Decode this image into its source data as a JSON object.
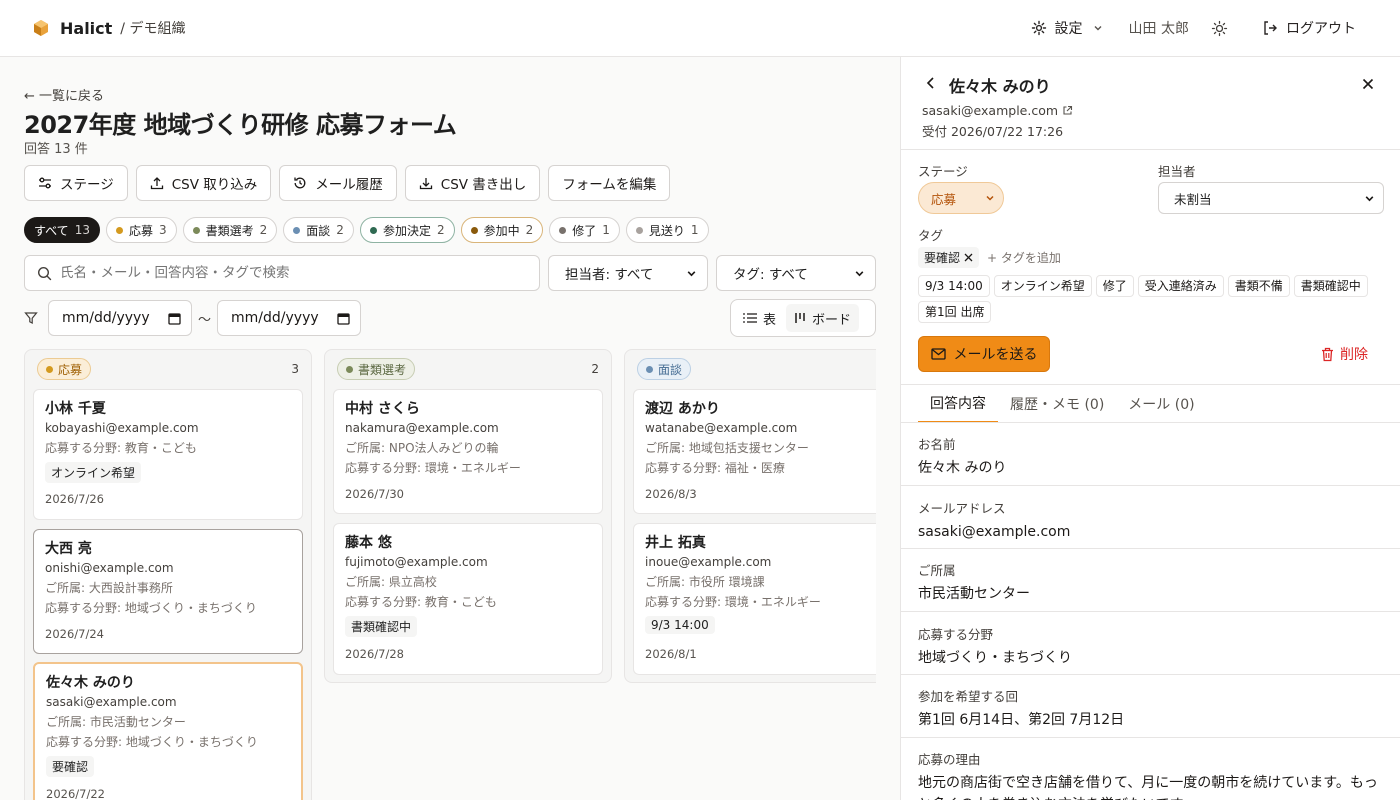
{
  "header": {
    "brand": "Halict",
    "org": "/ デモ組織",
    "settings_label": "設定",
    "user_name": "山田 太郎",
    "logout_label": "ログアウト"
  },
  "page": {
    "back_label": "← 一覧に戻る",
    "title": "2027年度 地域づくり研修 応募フォーム",
    "response_count": "回答 13 件"
  },
  "toolbar": {
    "stage": "ステージ",
    "csv_import": "CSV 取り込み",
    "mail_history": "メール履歴",
    "csv_export": "CSV 書き出し",
    "edit_form": "フォームを編集"
  },
  "filters": [
    {
      "label": "すべて",
      "count": "13",
      "color": ""
    },
    {
      "label": "応募",
      "count": "3",
      "color": "#d49a1f"
    },
    {
      "label": "書類選考",
      "count": "2",
      "color": "#7c8a5a"
    },
    {
      "label": "面談",
      "count": "2",
      "color": "#6b8fb3"
    },
    {
      "label": "参加決定",
      "count": "2",
      "color": "#2f6a52"
    },
    {
      "label": "参加中",
      "count": "2",
      "color": "#8a5a0c"
    },
    {
      "label": "修了",
      "count": "1",
      "color": "#78716c"
    },
    {
      "label": "見送り",
      "count": "1",
      "color": "#a8a29e"
    }
  ],
  "search": {
    "placeholder": "氏名・メール・回答内容・タグで検索"
  },
  "assignee_filter": "担当者: すべて",
  "tag_filter": "タグ: すべて",
  "date_from": "mm/dd/yyyy",
  "date_to": "mm/dd/yyyy",
  "date_sep": "〜",
  "view": {
    "table": "表",
    "board": "ボード"
  },
  "columns": [
    {
      "stage": "応募",
      "count": "3",
      "cards": [
        {
          "name": "小林 千夏",
          "email": "kobayashi@example.com",
          "lines": [
            "応募する分野: 教育・こども"
          ],
          "tag": "オンライン希望",
          "date": "2026/7/26"
        },
        {
          "name": "大西 亮",
          "email": "onishi@example.com",
          "lines": [
            "ご所属: 大西設計事務所",
            "応募する分野: 地域づくり・まちづくり"
          ],
          "tag": "",
          "date": "2026/7/24"
        },
        {
          "name": "佐々木 みのり",
          "email": "sasaki@example.com",
          "lines": [
            "ご所属: 市民活動センター",
            "応募する分野: 地域づくり・まちづくり"
          ],
          "tag": "要確認",
          "date": "2026/7/22"
        }
      ]
    },
    {
      "stage": "書類選考",
      "count": "2",
      "cards": [
        {
          "name": "中村 さくら",
          "email": "nakamura@example.com",
          "lines": [
            "ご所属: NPO法人みどりの輪",
            "応募する分野: 環境・エネルギー"
          ],
          "tag": "",
          "date": "2026/7/30"
        },
        {
          "name": "藤本 悠",
          "email": "fujimoto@example.com",
          "lines": [
            "ご所属: 県立高校",
            "応募する分野: 教育・こども"
          ],
          "tag": "書類確認中",
          "date": "2026/7/28"
        }
      ]
    },
    {
      "stage": "面談",
      "count": "",
      "cards": [
        {
          "name": "渡辺 あかり",
          "email": "watanabe@example.com",
          "lines": [
            "ご所属: 地域包括支援センター",
            "応募する分野: 福祉・医療"
          ],
          "tag": "",
          "date": "2026/8/3"
        },
        {
          "name": "井上 拓真",
          "email": "inoue@example.com",
          "lines": [
            "ご所属: 市役所 環境課",
            "応募する分野: 環境・エネルギー"
          ],
          "tag": "9/3 14:00",
          "date": "2026/8/1"
        }
      ]
    }
  ],
  "panel": {
    "name": "佐々木 みのり",
    "email": "sasaki@example.com",
    "received": "受付 2026/07/22 17:26",
    "stage_label": "ステージ",
    "stage_value": "応募",
    "assignee_label": "担当者",
    "assignee_value": "未割当",
    "tags_label": "タグ",
    "tag": "要確認",
    "tag_add": "+ タグを追加",
    "suggestions": [
      "9/3 14:00",
      "オンライン希望",
      "修了",
      "受入連絡済み",
      "書類不備",
      "書類確認中",
      "第1回 出席"
    ],
    "send_mail": "メールを送る",
    "delete": "削除",
    "tabs": [
      "回答内容",
      "履歴・メモ (0)",
      "メール (0)"
    ],
    "fields": [
      {
        "label": "お名前",
        "value": "佐々木 みのり"
      },
      {
        "label": "メールアドレス",
        "value": "sasaki@example.com"
      },
      {
        "label": "ご所属",
        "value": "市民活動センター"
      },
      {
        "label": "応募する分野",
        "value": "地域づくり・まちづくり"
      },
      {
        "label": "参加を希望する回",
        "value": "第1回 6月14日、第2回 7月12日"
      },
      {
        "label": "応募の理由",
        "value": "地元の商店街で空き店舗を借りて、月に一度の朝市を続けています。もっと多くの人を巻き込む方法を学びたいです。"
      }
    ]
  },
  "colors": {
    "accent": "#f08b16",
    "danger": "#dc2626"
  }
}
